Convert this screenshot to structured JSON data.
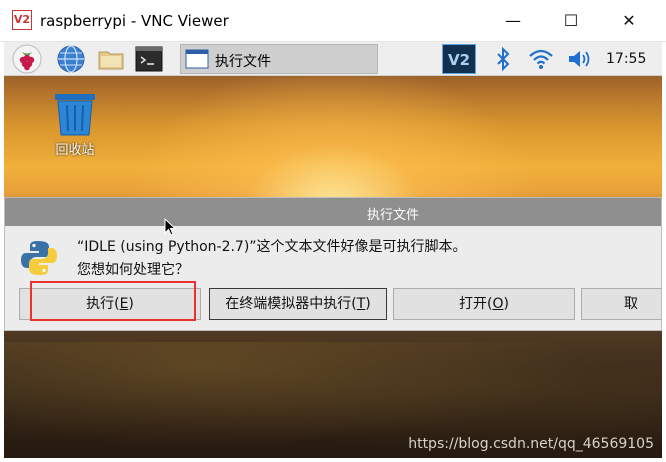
{
  "window": {
    "title": "raspberrypi - VNC Viewer",
    "logo_text": "V2",
    "minimize_glyph": "—",
    "maximize_glyph": "☐",
    "close_glyph": "✕"
  },
  "taskbar": {
    "active_task": "执行文件",
    "vnc_icon_text": "V2",
    "time": "17:55",
    "icons": [
      "raspberry-icon",
      "globe-icon",
      "folder-icon",
      "terminal-icon",
      "vnc-server-icon",
      "bluetooth-icon",
      "wifi-icon",
      "volume-icon"
    ]
  },
  "desktop": {
    "trash_label": "回收站",
    "watermark": "https://blog.csdn.net/qq_46569105"
  },
  "dialog": {
    "title": "执行文件",
    "message_line1": "“IDLE (using Python-2.7)”这个文本文件好像是可执行脚本。",
    "message_line2": "您想如何处理它？",
    "buttons": {
      "execute": {
        "text": "执行(",
        "key": "E",
        "close": ")"
      },
      "terminal": {
        "text": "在终端模拟器中执行(",
        "key": "T",
        "close": ")"
      },
      "open": {
        "text": "打开(",
        "key": "O",
        "close": ")"
      },
      "cancel": {
        "text": "取"
      }
    }
  },
  "colors": {
    "highlight_box": "#e8322e",
    "dialog_titlebar": "#8f8f8f",
    "taskbar_bg": "#eeeeee"
  }
}
